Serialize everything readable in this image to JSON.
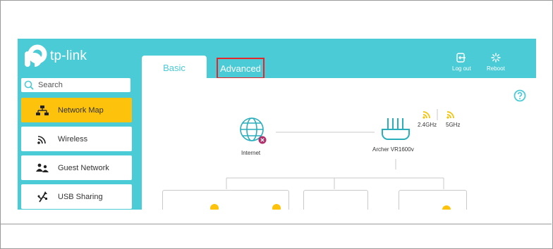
{
  "colors": {
    "header": "#4acbd6",
    "active_nav": "#fdc20c",
    "tab_highlight_border": "#e3262b",
    "wifi_icon": "#f2c40f",
    "error_badge": "#b0306b",
    "text": "#333333"
  },
  "brand": {
    "logo_text": "tp-link"
  },
  "header": {
    "tabs": [
      {
        "label": "Basic",
        "active": true
      },
      {
        "label": "Advanced",
        "active": false,
        "highlighted": true
      }
    ],
    "actions": [
      {
        "label": "Log out",
        "icon": "logout-icon"
      },
      {
        "label": "Reboot",
        "icon": "reboot-icon"
      }
    ]
  },
  "sidebar": {
    "search": {
      "placeholder": "Search",
      "icon": "search-icon"
    },
    "items": [
      {
        "label": "Network Map",
        "icon": "network-map-icon",
        "active": true
      },
      {
        "label": "Wireless",
        "icon": "wireless-icon",
        "active": false
      },
      {
        "label": "Guest Network",
        "icon": "guest-network-icon",
        "active": false
      },
      {
        "label": "USB Sharing",
        "icon": "usb-icon",
        "active": false
      }
    ]
  },
  "network_map": {
    "internet": {
      "label": "Internet",
      "icon": "globe-icon",
      "status": "disconnected"
    },
    "router": {
      "label": "Archer VR1600v",
      "icon": "router-icon",
      "bands": [
        "2.4GHz",
        "5GHz"
      ]
    },
    "help_icon": "help-icon"
  }
}
